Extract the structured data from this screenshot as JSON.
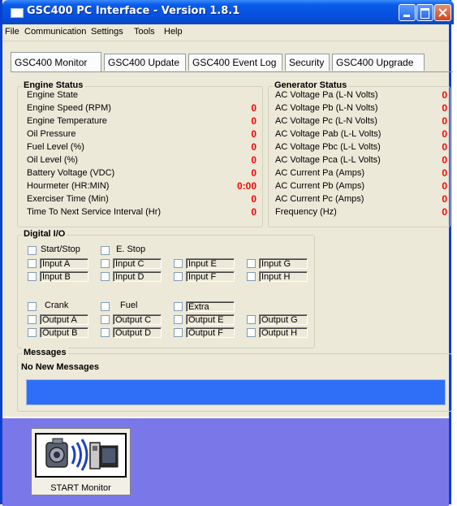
{
  "window": {
    "title": "GSC400 PC Interface - Version 1.8.1"
  },
  "menu": [
    "File",
    "Communication",
    "Settings",
    "Tools",
    "Help"
  ],
  "tabs": [
    "GSC400 Monitor",
    "GSC400 Update",
    "GSC400 Event Log",
    "Security",
    "GSC400 Upgrade"
  ],
  "engine": {
    "title": "Engine Status",
    "rows": [
      {
        "label": "Engine State",
        "value": ""
      },
      {
        "label": "Engine Speed (RPM)",
        "value": "0"
      },
      {
        "label": "Engine Temperature",
        "value": "0"
      },
      {
        "label": "Oil Pressure",
        "value": "0"
      },
      {
        "label": "Fuel Level (%)",
        "value": "0"
      },
      {
        "label": "Oil Level (%)",
        "value": "0"
      },
      {
        "label": "Battery Voltage (VDC)",
        "value": "0"
      },
      {
        "label": "Hourmeter (HR:MIN)",
        "value": "0:00"
      },
      {
        "label": "Exerciser Time (Min)",
        "value": "0"
      },
      {
        "label": "Time To Next Service Interval (Hr)",
        "value": "0"
      }
    ]
  },
  "generator": {
    "title": "Generator Status",
    "rows": [
      {
        "label": "AC Voltage Pa (L-N Volts)",
        "value": "0"
      },
      {
        "label": "AC Voltage Pb (L-N Volts)",
        "value": "0"
      },
      {
        "label": "AC Voltage Pc (L-N Volts)",
        "value": "0"
      },
      {
        "label": "AC Voltage Pab (L-L Volts)",
        "value": "0"
      },
      {
        "label": "AC Voltage Pbc (L-L Volts)",
        "value": "0"
      },
      {
        "label": "AC Voltage Pca (L-L Volts)",
        "value": "0"
      },
      {
        "label": "AC Current Pa (Amps)",
        "value": "0"
      },
      {
        "label": "AC Current Pb (Amps)",
        "value": "0"
      },
      {
        "label": "AC Current Pc (Amps)",
        "value": "0"
      },
      {
        "label": "Frequency (Hz)",
        "value": "0"
      }
    ]
  },
  "digital_io": {
    "title": "Digital I/O",
    "start_stop": "Start/Stop",
    "e_stop": "E. Stop",
    "inputs": [
      "Input A",
      "Input B",
      "Input C",
      "Input D",
      "Input E",
      "Input F",
      "Input G",
      "Input H"
    ],
    "crank": "Crank",
    "fuel": "Fuel",
    "extra": "Extra",
    "outputs": [
      "Output A",
      "Output B",
      "Output C",
      "Output D",
      "Output E",
      "Output F",
      "Output G",
      "Output H"
    ]
  },
  "messages": {
    "title": "Messages",
    "text": "No New Messages"
  },
  "start_monitor": {
    "label": "START Monitor"
  },
  "colors": {
    "titlebar": "#0a5be8",
    "value_red": "#ff0000",
    "bottom_bg": "#7a78e8",
    "message_bar": "#2f6ff7"
  }
}
